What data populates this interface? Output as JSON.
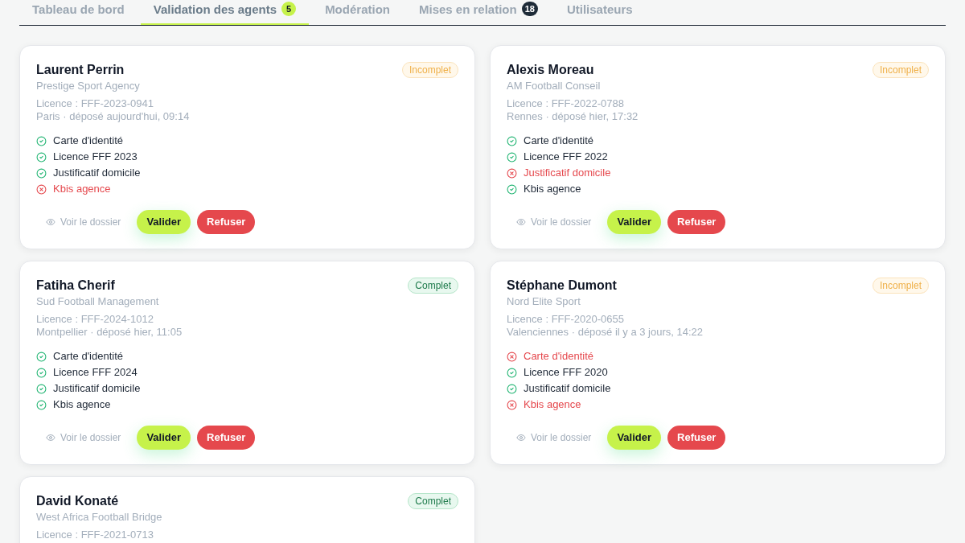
{
  "tabs": [
    {
      "label": "Tableau de bord",
      "selected": false
    },
    {
      "label": "Validation des agents",
      "selected": true,
      "badge": {
        "count": "5",
        "kind": "highlight"
      }
    },
    {
      "label": "Modération",
      "selected": false
    },
    {
      "label": "Mises en relation",
      "selected": false,
      "badge": {
        "count": "18",
        "kind": "dark"
      }
    },
    {
      "label": "Utilisateurs",
      "selected": false
    }
  ],
  "agents": [
    {
      "name": "Laurent Perrin",
      "status": {
        "label": "Incomplet",
        "kind": "incomplete"
      },
      "agency": "Prestige Sport Agency",
      "licence": "Licence : FFF-2023-0941",
      "location": "Paris · déposé aujourd'hui, 09:14",
      "documents": [
        {
          "label": "Carte d'identité",
          "ok": true
        },
        {
          "label": "Licence FFF 2023",
          "ok": true
        },
        {
          "label": "Justificatif domicile",
          "ok": true
        },
        {
          "label": "Kbis agence",
          "ok": false
        }
      ],
      "actions": {
        "view": "Voir le dossier",
        "validate": "Valider",
        "reject": "Refuser"
      }
    },
    {
      "name": "Alexis Moreau",
      "status": {
        "label": "Incomplet",
        "kind": "incomplete"
      },
      "agency": "AM Football Conseil",
      "licence": "Licence : FFF-2022-0788",
      "location": "Rennes · déposé hier, 17:32",
      "documents": [
        {
          "label": "Carte d'identité",
          "ok": true
        },
        {
          "label": "Licence FFF 2022",
          "ok": true
        },
        {
          "label": "Justificatif domicile",
          "ok": false
        },
        {
          "label": "Kbis agence",
          "ok": true
        }
      ],
      "actions": {
        "view": "Voir le dossier",
        "validate": "Valider",
        "reject": "Refuser"
      }
    },
    {
      "name": "Fatiha Cherif",
      "status": {
        "label": "Complet",
        "kind": "complete"
      },
      "agency": "Sud Football Management",
      "licence": "Licence : FFF-2024-1012",
      "location": "Montpellier · déposé hier, 11:05",
      "documents": [
        {
          "label": "Carte d'identité",
          "ok": true
        },
        {
          "label": "Licence FFF 2024",
          "ok": true
        },
        {
          "label": "Justificatif domicile",
          "ok": true
        },
        {
          "label": "Kbis agence",
          "ok": true
        }
      ],
      "actions": {
        "view": "Voir le dossier",
        "validate": "Valider",
        "reject": "Refuser"
      }
    },
    {
      "name": "Stéphane Dumont",
      "status": {
        "label": "Incomplet",
        "kind": "incomplete"
      },
      "agency": "Nord Elite Sport",
      "licence": "Licence : FFF-2020-0655",
      "location": "Valenciennes · déposé il y a 3 jours, 14:22",
      "documents": [
        {
          "label": "Carte d'identité",
          "ok": false
        },
        {
          "label": "Licence FFF 2020",
          "ok": true
        },
        {
          "label": "Justificatif domicile",
          "ok": true
        },
        {
          "label": "Kbis agence",
          "ok": false
        }
      ],
      "actions": {
        "view": "Voir le dossier",
        "validate": "Valider",
        "reject": "Refuser"
      }
    },
    {
      "name": "David Konaté",
      "status": {
        "label": "Complet",
        "kind": "complete"
      },
      "agency": "West Africa Football Bridge",
      "licence": "Licence : FFF-2021-0713"
    }
  ]
}
